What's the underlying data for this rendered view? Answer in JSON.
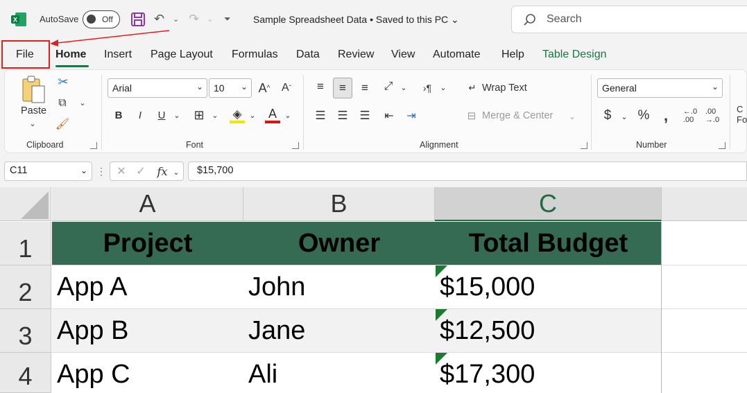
{
  "titlebar": {
    "autosave_label": "AutoSave",
    "autosave_state": "Off",
    "doc_title": "Sample Spreadsheet Data • Saved to this PC ⌄",
    "search_placeholder": "Search"
  },
  "tabs": [
    "File",
    "Home",
    "Insert",
    "Page Layout",
    "Formulas",
    "Data",
    "Review",
    "View",
    "Automate",
    "Help",
    "Table Design"
  ],
  "active_tab": "Home",
  "ribbon": {
    "clipboard": {
      "paste_label": "Paste",
      "group_label": "Clipboard"
    },
    "font": {
      "font_name": "Arial",
      "font_size": "10",
      "group_label": "Font"
    },
    "alignment": {
      "wrap_text": "Wrap Text",
      "merge_center": "Merge & Center",
      "group_label": "Alignment"
    },
    "number": {
      "format": "General",
      "group_label": "Number"
    }
  },
  "formula_bar": {
    "name_box": "C11",
    "formula": "$15,700"
  },
  "columns": [
    "A",
    "B",
    "C"
  ],
  "selected_column": "C",
  "rows": [
    "1",
    "2",
    "3",
    "4"
  ],
  "table": {
    "headers": [
      "Project",
      "Owner",
      "Total Budget"
    ],
    "body": [
      [
        "App A",
        "John",
        "$15,000"
      ],
      [
        "App B",
        "Jane",
        "$12,500"
      ],
      [
        "App C",
        "Ali",
        "$17,300"
      ]
    ]
  },
  "colors": {
    "header_fill": "#346b52",
    "excel_green": "#1f7346",
    "highlight_red": "#e02020"
  }
}
